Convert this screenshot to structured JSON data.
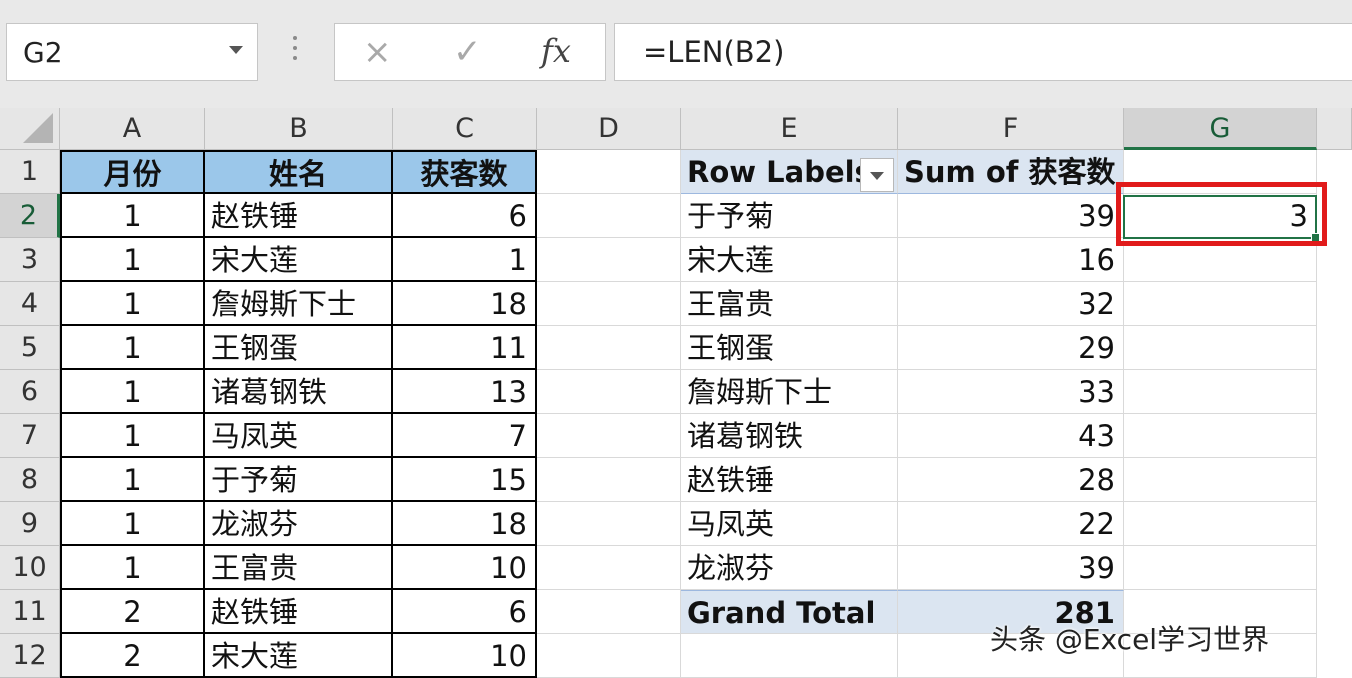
{
  "formula_bar": {
    "name_box": "G2",
    "cancel_icon": "×",
    "enter_icon": "✓",
    "fx_label": "fx",
    "formula": "=LEN(B2)"
  },
  "columns": [
    "A",
    "B",
    "C",
    "D",
    "E",
    "F",
    "G"
  ],
  "rows": [
    "1",
    "2",
    "3",
    "4",
    "5",
    "6",
    "7",
    "8",
    "9",
    "10",
    "11",
    "12"
  ],
  "source_table": {
    "headers": [
      "月份",
      "姓名",
      "获客数"
    ],
    "rows": [
      [
        "1",
        "赵铁锤",
        "6"
      ],
      [
        "1",
        "宋大莲",
        "1"
      ],
      [
        "1",
        "詹姆斯下士",
        "18"
      ],
      [
        "1",
        "王钢蛋",
        "11"
      ],
      [
        "1",
        "诸葛钢铁",
        "13"
      ],
      [
        "1",
        "马凤英",
        "7"
      ],
      [
        "1",
        "于予菊",
        "15"
      ],
      [
        "1",
        "龙淑芬",
        "18"
      ],
      [
        "1",
        "王富贵",
        "10"
      ],
      [
        "2",
        "赵铁锤",
        "6"
      ],
      [
        "2",
        "宋大莲",
        "10"
      ]
    ]
  },
  "pivot": {
    "row_labels": "Row Labels",
    "sum_label": "Sum of 获客数",
    "rows": [
      [
        "于予菊",
        "39"
      ],
      [
        "宋大莲",
        "16"
      ],
      [
        "王富贵",
        "32"
      ],
      [
        "王钢蛋",
        "29"
      ],
      [
        "詹姆斯下士",
        "33"
      ],
      [
        "诸葛钢铁",
        "43"
      ],
      [
        "赵铁锤",
        "28"
      ],
      [
        "马凤英",
        "22"
      ],
      [
        "龙淑芬",
        "39"
      ]
    ],
    "grand_total_label": "Grand Total",
    "grand_total": "281"
  },
  "g2_value": "3",
  "watermark": "头条 @Excel学习世界",
  "colors": {
    "header_fill": "#9bc7ea",
    "pivot_fill": "#dbe5f1",
    "highlight": "#e11b1b",
    "selection": "#217346"
  }
}
